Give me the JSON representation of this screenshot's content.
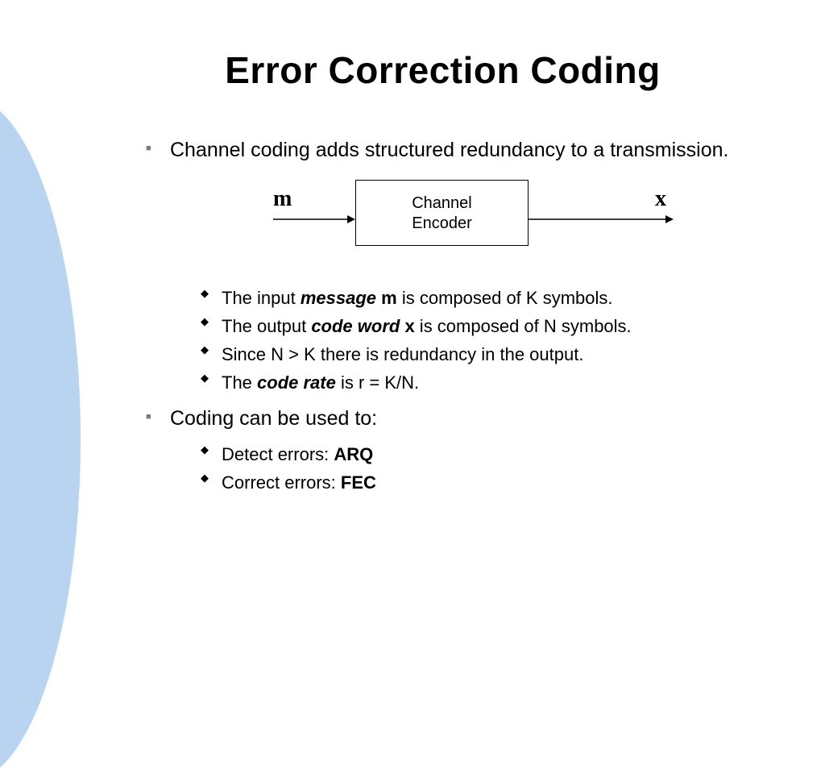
{
  "title": "Error Correction Coding",
  "bullet1": "Channel coding adds structured redundancy to a transmission.",
  "diagram": {
    "input_label": "m",
    "output_label": "x",
    "box_line1": "Channel",
    "box_line2": "Encoder"
  },
  "sub1": {
    "a": "The input ",
    "b": "message",
    "c": " m",
    "d": " is composed of K symbols."
  },
  "sub2": {
    "a": "The output ",
    "b": "code word",
    "c": " x",
    "d": " is composed of N symbols."
  },
  "sub3": "Since N > K there is redundancy in the output.",
  "sub4": {
    "a": "The ",
    "b": "code rate",
    "c": " is r = K/N."
  },
  "bullet2": "Coding can be used to:",
  "sub5": {
    "a": "Detect errors: ",
    "b": "ARQ"
  },
  "sub6": {
    "a": "Correct errors: ",
    "b": "FEC"
  }
}
